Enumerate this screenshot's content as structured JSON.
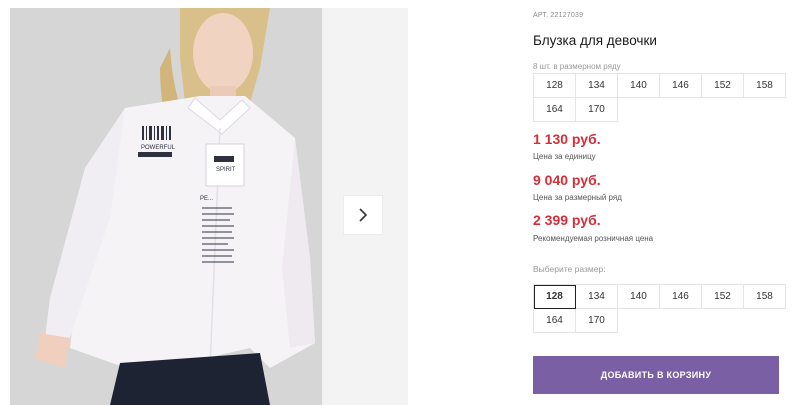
{
  "product": {
    "sku": "АРТ. 22127039",
    "title": "Блузка для девочки",
    "pack_note": "8 шт. в размерном ряду"
  },
  "pack_sizes": [
    "128",
    "134",
    "140",
    "146",
    "152",
    "158",
    "164",
    "170"
  ],
  "prices": [
    {
      "value": "1 130 руб.",
      "label": "Цена за единицу"
    },
    {
      "value": "9 040 руб.",
      "label": "Цена за размерный ряд"
    },
    {
      "value": "2 399 руб.",
      "label": "Рекомендуемая розничная цена"
    }
  ],
  "size_select": {
    "label": "Выберите размер:",
    "options": [
      "128",
      "134",
      "140",
      "146",
      "152",
      "158",
      "164",
      "170"
    ],
    "selected": "128"
  },
  "cart_button": "ДОБАВИТЬ В КОРЗИНУ",
  "image": {
    "print_texts": [
      "POWERFUL",
      "SPIRIT",
      "PE..."
    ],
    "next_icon": "chevron-right-icon"
  },
  "colors": {
    "price": "#d32f3a",
    "button": "#7b5fa4",
    "border": "#e4e4e4"
  }
}
